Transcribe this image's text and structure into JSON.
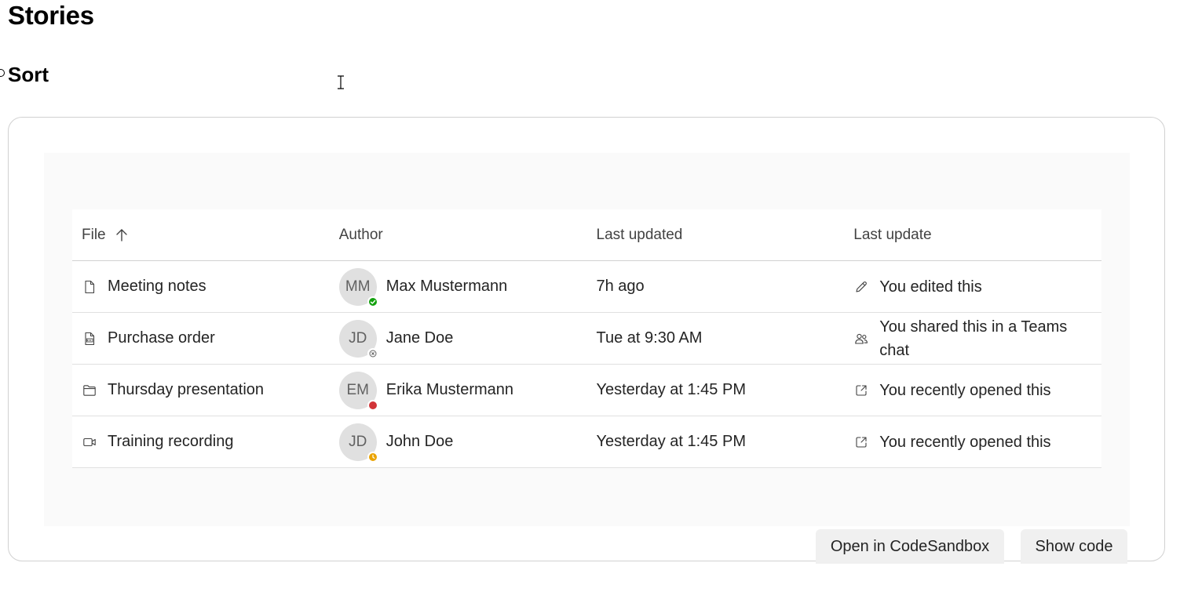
{
  "page": {
    "title": "Stories",
    "section_title": "Sort"
  },
  "table": {
    "columns": [
      {
        "label": "File",
        "sort": "ascending",
        "icon": "arrow-up-icon"
      },
      {
        "label": "Author"
      },
      {
        "label": "Last updated"
      },
      {
        "label": "Last update"
      }
    ],
    "rows": [
      {
        "file": {
          "label": "Meeting notes",
          "icon": "document-icon"
        },
        "author": {
          "initials": "MM",
          "name": "Max Mustermann",
          "status": "available",
          "status_color": "#13a10e"
        },
        "last_updated": "7h ago",
        "last_update": {
          "label": "You edited this",
          "icon": "pencil-icon"
        }
      },
      {
        "file": {
          "label": "Purchase order",
          "icon": "document-pdf-icon"
        },
        "author": {
          "initials": "JD",
          "name": "Jane Doe",
          "status": "offline",
          "status_color": "#616161"
        },
        "last_updated": "Tue at 9:30 AM",
        "last_update": {
          "label": "You shared this in a Teams chat",
          "icon": "people-icon"
        }
      },
      {
        "file": {
          "label": "Thursday presentation",
          "icon": "folder-icon"
        },
        "author": {
          "initials": "EM",
          "name": "Erika Mustermann",
          "status": "busy",
          "status_color": "#d13438"
        },
        "last_updated": "Yesterday at 1:45 PM",
        "last_update": {
          "label": "You recently opened this",
          "icon": "open-icon"
        }
      },
      {
        "file": {
          "label": "Training recording",
          "icon": "video-icon"
        },
        "author": {
          "initials": "JD",
          "name": "John Doe",
          "status": "away",
          "status_color": "#eaa300"
        },
        "last_updated": "Yesterday at 1:45 PM",
        "last_update": {
          "label": "You recently opened this",
          "icon": "open-icon"
        }
      }
    ]
  },
  "actions": {
    "sandbox_label": "Open in CodeSandbox",
    "code_label": "Show code"
  }
}
